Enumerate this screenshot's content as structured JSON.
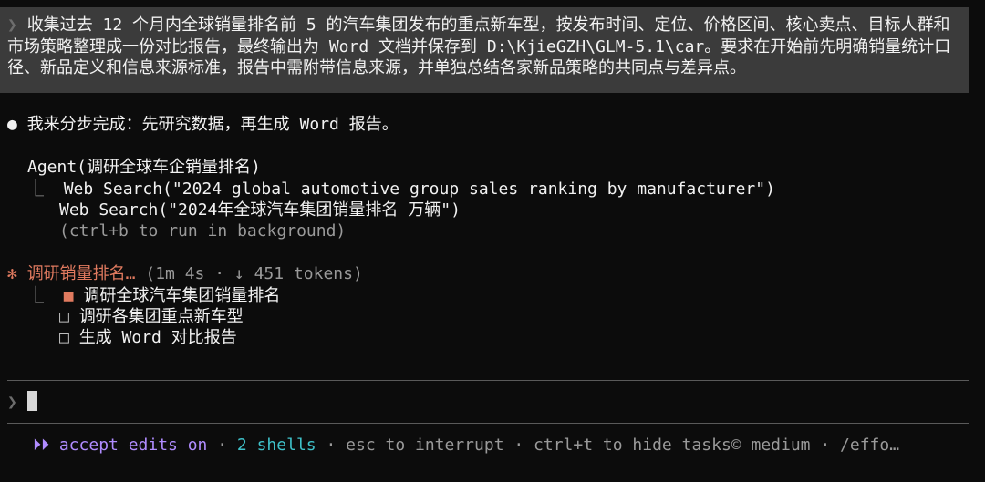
{
  "user_prompt": {
    "marker": "❯",
    "text": "收集过去 12 个月内全球销量排名前 5 的汽车集团发布的重点新车型，按发布时间、定位、价格区间、核心卖点、目标人群和市场策略整理成一份对比报告，最终输出为 Word 文档并保存到 D:\\KjieGZH\\GLM-5.1\\car。要求在开始前先明确销量统计口径、新品定义和信息来源标准，报告中需附带信息来源，并单独总结各家新品策略的共同点与差异点。"
  },
  "assistant": {
    "bullet": "●",
    "message": "我来分步完成：先研究数据，再生成 Word 报告。"
  },
  "agent": {
    "call": "Agent(调研全球车企销量排名)",
    "branch": "⎿",
    "searches": [
      "Web Search(\"2024 global automotive group sales ranking by manufacturer\")",
      "Web Search(\"2024年全球汽车集团销量排名 万辆\")"
    ],
    "hint": "(ctrl+b to run in background)"
  },
  "status": {
    "spinner": "✻",
    "label": "调研销量排名…",
    "meta": "(1m 4s · ↓ 451 tokens)"
  },
  "tasks": {
    "branch": "⎿",
    "items": [
      {
        "icon": "■",
        "label": "调研全球汽车集团销量排名",
        "state": "in-progress"
      },
      {
        "icon": "□",
        "label": "调研各集团重点新车型",
        "state": "pending"
      },
      {
        "icon": "□",
        "label": "生成 Word 对比报告",
        "state": "pending"
      }
    ]
  },
  "input": {
    "marker": "❯",
    "value": ""
  },
  "footer": {
    "mode_icon": "⏵⏵",
    "mode_label": "accept edits on",
    "sep1": " · ",
    "shells": "2 shells",
    "sep2": " · ",
    "interrupt": "esc to interrupt",
    "sep3": " · ",
    "hide_tasks": "ctrl+t to hide tasks",
    "effort_icon": "©",
    "effort": "medium",
    "sep4": " · ",
    "effort_cmd": "/effo…"
  },
  "colors": {
    "background": "#0c0c0c",
    "prompt_bg": "#3b3b3b",
    "accent_orange": "#e07a5f",
    "accent_purple": "#b08cff",
    "accent_teal": "#3fc1c9"
  }
}
